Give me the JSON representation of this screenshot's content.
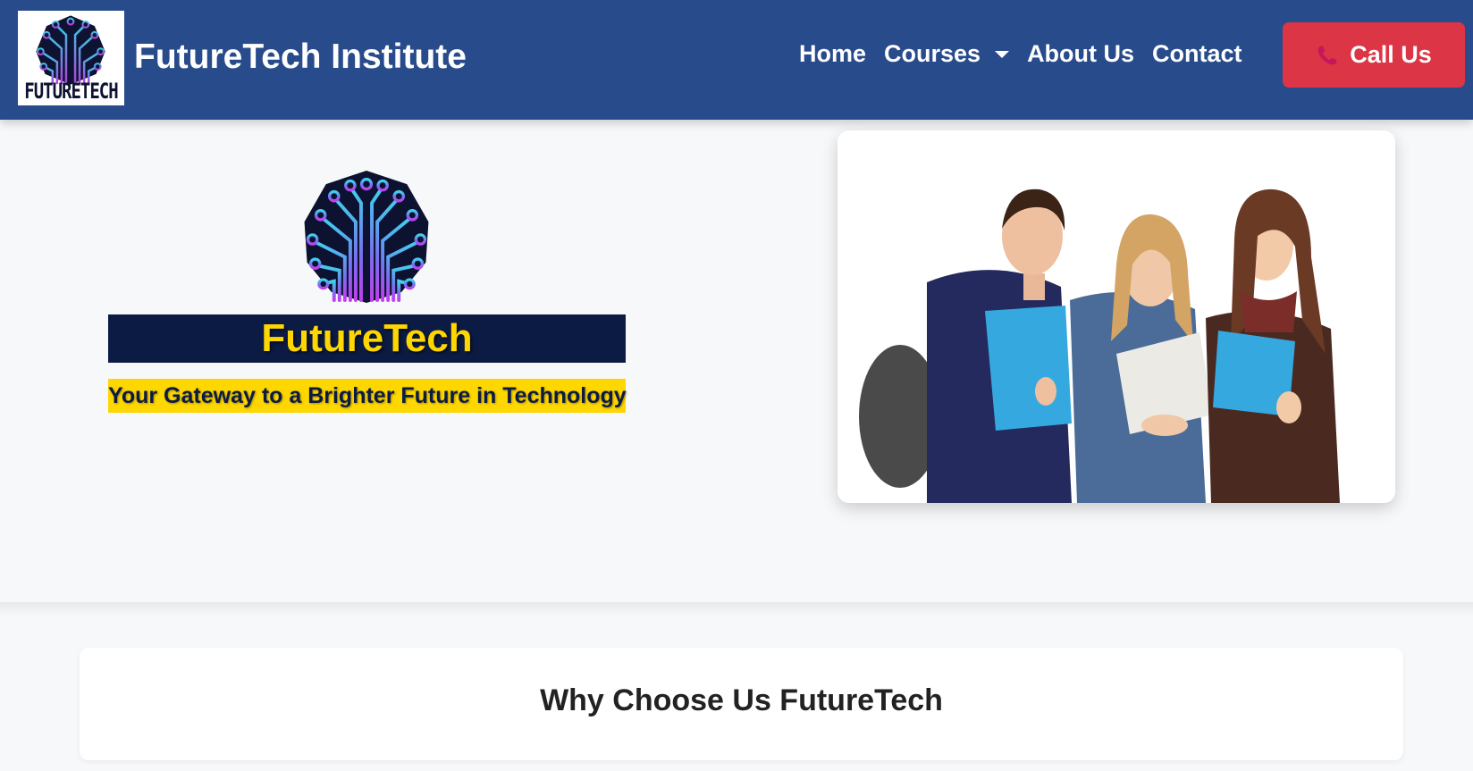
{
  "navbar": {
    "logo_word": "FUTURETECH",
    "brand": "FutureTech Institute",
    "links": {
      "home": "Home",
      "courses": "Courses",
      "about": "About Us",
      "contact": "Contact"
    },
    "call_button": "Call Us",
    "icons": [
      "tree-logo-icon",
      "chevron-down-icon",
      "phone-icon"
    ],
    "colors": {
      "background": "#284b8c",
      "call_button": "#dc3545"
    }
  },
  "hero": {
    "title": "FutureTech",
    "tagline": "Your Gateway to a Brighter Future in Technology",
    "colors": {
      "title_bg": "#0c1b44",
      "accent": "#ffd700"
    }
  },
  "why_section": {
    "title": "Why Choose Us FutureTech"
  }
}
